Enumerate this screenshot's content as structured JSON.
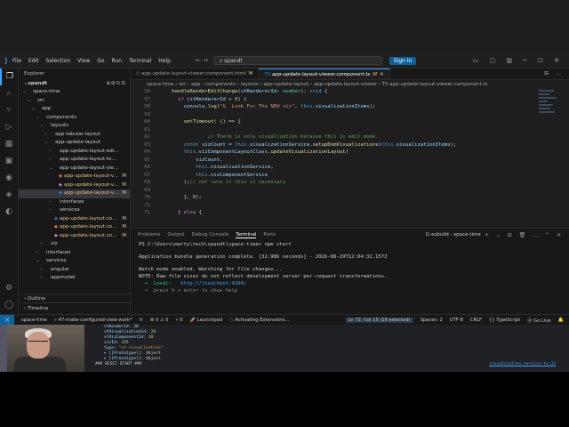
{
  "titlebar": {
    "menu": [
      "File",
      "Edit",
      "Selection",
      "View",
      "Go",
      "Run",
      "Terminal",
      "Help"
    ],
    "search": "spandt",
    "signin": "Sign In"
  },
  "explorer": {
    "title": "Explorer",
    "project": "spandt",
    "tree": [
      {
        "label": "space-time",
        "depth": 0,
        "arrow": "⌄",
        "badge": ""
      },
      {
        "label": "src",
        "depth": 1,
        "arrow": "⌄",
        "badge": ""
      },
      {
        "label": "app",
        "depth": 2,
        "arrow": "⌄",
        "badge": ""
      },
      {
        "label": "components",
        "depth": 3,
        "arrow": "⌄",
        "badge": ""
      },
      {
        "label": "layouts",
        "depth": 4,
        "arrow": "⌄",
        "badge": ""
      },
      {
        "label": "app-tabular-layout",
        "depth": 5,
        "arrow": "›",
        "badge": ""
      },
      {
        "label": "app-update-layout",
        "depth": 5,
        "arrow": "⌄",
        "badge": ""
      },
      {
        "label": "app-update-layout-editor",
        "depth": 6,
        "arrow": "›",
        "badge": ""
      },
      {
        "label": "app-update-layout-toolbar",
        "depth": 6,
        "arrow": "›",
        "badge": ""
      },
      {
        "label": "app-update-layout-viewer",
        "depth": 6,
        "arrow": "⌄",
        "badge": ""
      },
      {
        "label": "app-update-layout-viewer....",
        "depth": 7,
        "arrow": "",
        "badge": "M"
      },
      {
        "label": "app-update-layout-viewer....",
        "depth": 7,
        "arrow": "",
        "badge": "M"
      },
      {
        "label": "app-update-layout-viewer....",
        "depth": 7,
        "arrow": "",
        "badge": "M",
        "selected": true
      },
      {
        "label": "interfaces",
        "depth": 6,
        "arrow": "›",
        "badge": ""
      },
      {
        "label": "services",
        "depth": 6,
        "arrow": "›",
        "badge": ""
      },
      {
        "label": "app-update-layout.component....",
        "depth": 6,
        "arrow": "",
        "badge": "M"
      },
      {
        "label": "app-update-layout.component....",
        "depth": 6,
        "arrow": "",
        "badge": "M"
      },
      {
        "label": "app-update-layout.compon...",
        "depth": 6,
        "arrow": "",
        "badge": "M"
      },
      {
        "label": "viz",
        "depth": 4,
        "arrow": "›",
        "badge": ""
      },
      {
        "label": "interfaces",
        "depth": 3,
        "arrow": "›",
        "badge": ""
      },
      {
        "label": "services",
        "depth": 3,
        "arrow": "⌄",
        "badge": ""
      },
      {
        "label": "angular",
        "depth": 4,
        "arrow": "›",
        "badge": ""
      },
      {
        "label": "appmodel",
        "depth": 4,
        "arrow": "›",
        "badge": ""
      }
    ],
    "outline": "Outline",
    "timeline": "Timeline"
  },
  "editor": {
    "tabs": [
      {
        "label": "app-update-layout-viewer.component.html",
        "badge": "M",
        "active": false
      },
      {
        "label": "app-update-layout-viewer.component.ts",
        "badge": "M",
        "active": true
      }
    ],
    "breadcrumb": "space-time  ›  src  ›  app  ›  components  ›  layouts  ›  app-update-layout  ›  app-update-layout-viewer  ›  TS app-update-layout-viewer.component.ts",
    "lines": [
      {
        "n": "56",
        "html": "      <span class=\"fn\">handleRenderEditChange</span>(<span class=\"var\">stRendererId</span>: <span class=\"ty\">number</span>): <span class=\"kw2\">void</span> {"
      },
      {
        "n": "57",
        "html": "        <span class=\"kw\">if</span> (<span class=\"var\">stRendererId</span> &gt; <span class=\"num\">0</span>) {"
      },
      {
        "n": "58",
        "html": "          <span class=\"var\">console</span>.<span class=\"fn\">log</span>(<span class=\"str\">\"&amp;  Look For The NEW viz\"</span>, <span class=\"kw2\">this</span>.<span class=\"var\">visualizationItems</span>);"
      },
      {
        "n": "59",
        "html": ""
      },
      {
        "n": "60",
        "html": "          <span class=\"fn\">setTimeout</span>( () =&gt; {"
      },
      {
        "n": "61",
        "html": ""
      },
      {
        "n": "62",
        "html": "                  <span class=\"cm\">// There is only visualization because this is edit mode</span>"
      },
      {
        "n": "63",
        "html": "          <span class=\"kw2\">const</span> <span class=\"var\">vizCount</span> = <span class=\"kw2\">this</span>.<span class=\"var\">visualizationService</span>.<span class=\"fn\">setupDomVisualizations</span>(<span class=\"kw2\">this</span>.<span class=\"var\">visualizationItems</span>);"
      },
      {
        "n": "64",
        "html": "          <span class=\"kw2\">this</span>.<span class=\"var\">vizComponentLayoutClass</span>.<span class=\"fn\">updateVisualizationLayout</span>("
      },
      {
        "n": "65",
        "html": "              <span class=\"var\">vizCount</span>,"
      },
      {
        "n": "66",
        "html": "              <span class=\"kw2\">this</span>.<span class=\"var\">visualizationService</span>,"
      },
      {
        "n": "67",
        "html": "              <span class=\"kw2\">this</span>.<span class=\"var\">vizComponentService</span>"
      },
      {
        "n": "68",
        "html": "          );<span class=\"cm\">// not sure if this is necessary</span>"
      },
      {
        "n": "69",
        "html": ""
      },
      {
        "n": "70",
        "html": "          }, <span class=\"num\">0</span>);"
      },
      {
        "n": "71",
        "html": ""
      },
      {
        "n": "72",
        "html": "        } <span class=\"kw\">else</span> {"
      }
    ]
  },
  "panel": {
    "tabs": [
      "Problems",
      "Output",
      "Debug Console",
      "Terminal",
      "Ports"
    ],
    "active_tab": "Terminal",
    "terminal_name": "esbuild - space-time",
    "prompt": "PS C:\\Users\\marty\\tech\\spandt\\space-time> npm start",
    "bundle": "Application bundle generation complete. [32.986 seconds] - 2026-08-29T12:04:32.157Z",
    "watch1": "Watch mode enabled. Watching for file changes...",
    "watch2": "NOTE: Raw file sizes do not reflect development server per-request transformations.",
    "local_label": "  ➜  Local:   ",
    "local_url": "http://localhost:4200/",
    "help": "  ➜  press h + enter to show help"
  },
  "statusbar": {
    "branch": "space-time",
    "git": "47-make-configured-view-work*",
    "sync": "↻",
    "errors": "⊗ 0  ⚠ 0",
    "ports": "⑂ 0",
    "launchpad": "Launchpad",
    "activating": "Activating Extensions...",
    "position": "Ln 72, Col 15 (16 selected)",
    "spaces": "Spaces: 2",
    "encoding": "UTF-8",
    "eol": "CRLF",
    "lang": "{} TypeScript",
    "golive": "Go Live"
  },
  "devtools": {
    "lines": [
      {
        "key": "stRenderId",
        "val": "30",
        "kind": "v"
      },
      {
        "key": "stVisualizationId",
        "val": "20",
        "kind": "v"
      },
      {
        "key": "stVizComponentId",
        "val": "20",
        "kind": "v"
      },
      {
        "key": "vizId",
        "val": "195",
        "kind": "v"
      },
      {
        "key": "type",
        "val": "\"st-visualization\"",
        "kind": "s"
      },
      {
        "key": "▸ [[Prototype]]",
        "val": "Object",
        "kind": "p"
      },
      {
        "key": "▸ [[Prototype]]",
        "val": "Object",
        "kind": "p"
      }
    ],
    "last": "### RESET START ###",
    "source": "visualization.service.ts:33"
  }
}
